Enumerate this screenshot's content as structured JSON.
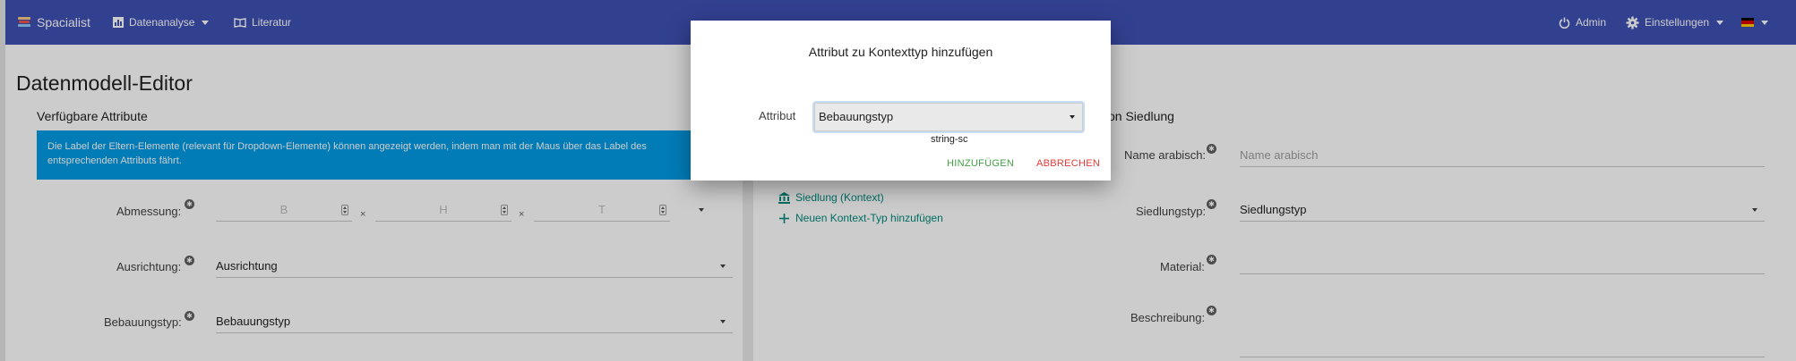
{
  "navbar": {
    "brand": "Spacialist",
    "analyse": "Datenanalyse",
    "literature": "Literatur",
    "admin": "Admin",
    "settings": "Einstellungen",
    "language_icon": "flag-de-icon"
  },
  "page": {
    "title": "Datenmodell-Editor",
    "available_title": "Verfügbare Attribute",
    "right_title": "von Siedlung",
    "info": "Die Label der Eltern-Elemente (relevant für Dropdown-Elemente) können angezeigt werden, indem man mit der Maus über das Label des entsprechenden Attributs fährt."
  },
  "left_fields": {
    "dimension_label": "Abmessung:",
    "dim_b": "B",
    "dim_h": "H",
    "dim_t": "T",
    "times": "×",
    "orientation_label": "Ausrichtung:",
    "orientation_value": "Ausrichtung",
    "building_label": "Bebauungstyp:",
    "building_value": "Bebauungstyp"
  },
  "context_list": {
    "item": "Siedlung (Kontext)",
    "add": "Neuen Kontext-Typ hinzufügen"
  },
  "right_fields": {
    "name_label": "Name arabisch:",
    "name_placeholder": "Name arabisch",
    "settlement_label": "Siedlungstyp:",
    "settlement_value": "Siedlungstyp",
    "material_label": "Material:",
    "description_label": "Beschreibung:"
  },
  "modal": {
    "title": "Attribut zu Kontexttyp hinzufügen",
    "attribute_label": "Attribut",
    "attribute_value": "Bebauungstyp",
    "hint": "string-sc",
    "add_button": "HINZUFÜGEN",
    "cancel_button": "ABBRECHEN"
  },
  "colors": {
    "navbar": "#3f51b5",
    "info": "#039be5",
    "add": "#43a047",
    "cancel": "#e53935",
    "link": "#00897b"
  }
}
